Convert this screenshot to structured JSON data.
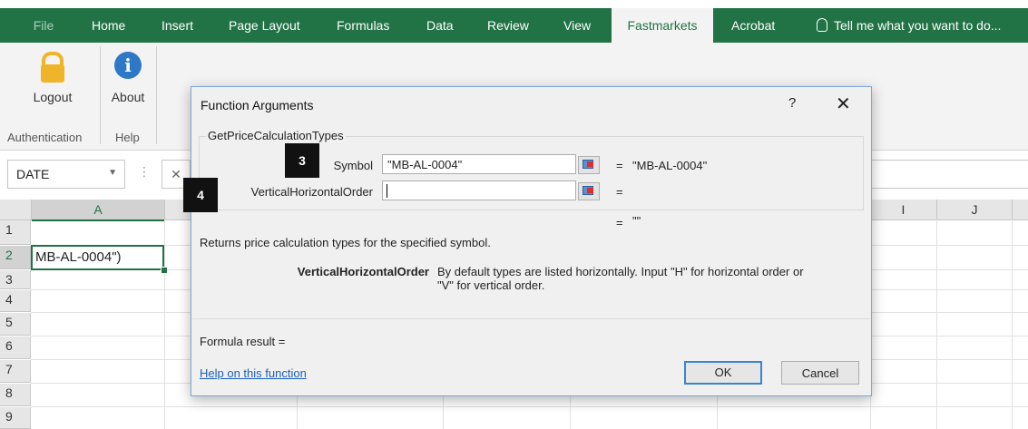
{
  "ribbon_tabs": [
    "File",
    "Home",
    "Insert",
    "Page Layout",
    "Formulas",
    "Data",
    "Review",
    "View",
    "Fastmarkets",
    "Acrobat"
  ],
  "active_tab": "Fastmarkets",
  "tell_me": "Tell me what you want to do...",
  "ribbon": {
    "logout_label": "Logout",
    "about_label": "About",
    "group_authentication": "Authentication",
    "group_help": "Help"
  },
  "namebox": {
    "value": "DATE"
  },
  "formula_bar": {
    "fx_label": "✕"
  },
  "columns": [
    "A",
    "I",
    "J"
  ],
  "rows": [
    "1",
    "2",
    "3",
    "4",
    "5",
    "6",
    "7",
    "8",
    "9"
  ],
  "active_cell": {
    "value": "MB-AL-0004\")"
  },
  "dialog": {
    "title": "Function Arguments",
    "help_glyph": "?",
    "close_glyph": "✕",
    "function_name": "GetPriceCalculationTypes",
    "args": [
      {
        "label": "Symbol",
        "value": "\"MB-AL-0004\"",
        "equals": "=",
        "result": "\"MB-AL-0004\""
      },
      {
        "label": "VerticalHorizontalOrder",
        "value": "",
        "equals": "=",
        "result": ""
      }
    ],
    "overall_equals": "=",
    "overall_result": "\"\"",
    "description": "Returns price calculation types for the specified symbol.",
    "arg_help_name": "VerticalHorizontalOrder",
    "arg_help_text_1": "By default types are listed horizontally. Input \"H\" for horizontal order or",
    "arg_help_text_2": "\"V\" for vertical order.",
    "formula_result": "Formula result =",
    "help_link": "Help on this function",
    "ok_label": "OK",
    "cancel_label": "Cancel"
  },
  "markers": [
    "3",
    "4"
  ],
  "colors": {
    "excel_green": "#217346",
    "ribbon_bg": "#f3f3f3",
    "dialog_border": "#7aa7d8",
    "link": "#1a5eb8"
  }
}
